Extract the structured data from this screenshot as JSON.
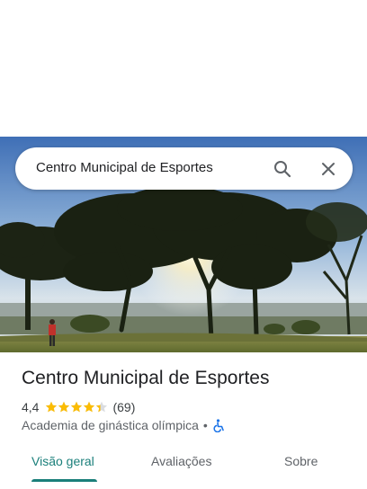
{
  "search": {
    "query": "Centro Municipal de Esportes"
  },
  "place": {
    "name": "Centro Municipal de Esportes",
    "rating": "4,4",
    "stars": 4.4,
    "reviews": "(69)",
    "category": "Academia de ginástica olímpica",
    "separator": "•"
  },
  "tabs": [
    {
      "label": "Visão geral",
      "active": true
    },
    {
      "label": "Avaliações",
      "active": false
    },
    {
      "label": "Sobre",
      "active": false
    }
  ],
  "colors": {
    "accent": "#1a7f7a",
    "star": "#fbbc04",
    "accessibility": "#1a73e8"
  },
  "icons": [
    "search-icon",
    "close-icon",
    "star-icon",
    "wheelchair-icon"
  ]
}
